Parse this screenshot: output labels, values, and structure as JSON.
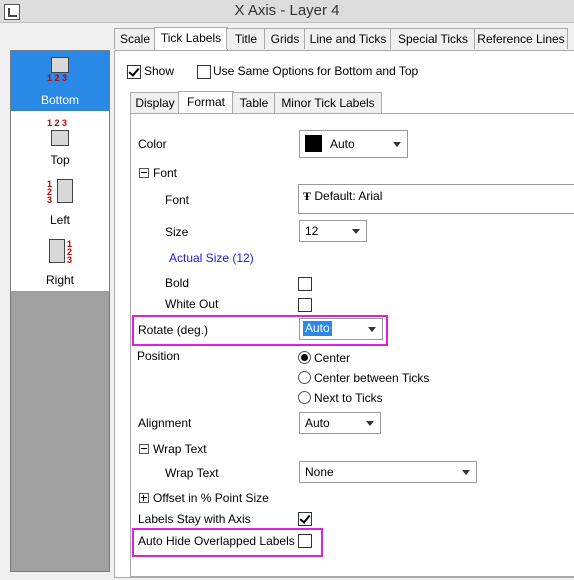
{
  "window": {
    "title": "X Axis - Layer 4"
  },
  "axes": [
    {
      "label": "Bottom",
      "nums": "1 2 3",
      "selected": true
    },
    {
      "label": "Top",
      "nums": "1 2 3",
      "selected": false
    },
    {
      "label": "Left",
      "nums": "1 2 3",
      "selected": false
    },
    {
      "label": "Right",
      "nums": "1 2 3",
      "selected": false
    }
  ],
  "tabs": [
    "Scale",
    "Tick Labels",
    "Title",
    "Grids",
    "Line and Ticks",
    "Special Ticks",
    "Reference Lines"
  ],
  "active_tab": "Tick Labels",
  "show": {
    "label": "Show",
    "checked": true
  },
  "same_options": {
    "label": "Use Same Options for Bottom and Top",
    "checked": false
  },
  "subtabs": [
    "Display",
    "Format",
    "Table",
    "Minor Tick Labels"
  ],
  "active_subtab": "Format",
  "format": {
    "color_label": "Color",
    "color_value": "Auto",
    "font_group": "Font",
    "font_label": "Font",
    "font_value": "Default: Arial",
    "size_label": "Size",
    "size_value": "12",
    "actual_size": "Actual Size (12)",
    "bold_label": "Bold",
    "bold_checked": false,
    "whiteout_label": "White Out",
    "whiteout_checked": false,
    "rotate_label": "Rotate (deg.)",
    "rotate_value": "Auto",
    "position_label": "Position",
    "position_options": [
      "Center",
      "Center between Ticks",
      "Next to Ticks"
    ],
    "position_selected": "Center",
    "alignment_label": "Alignment",
    "alignment_value": "Auto",
    "wrap_group": "Wrap Text",
    "wrap_label": "Wrap Text",
    "wrap_value": "None",
    "offset_group": "Offset in % Point Size",
    "stay_label": "Labels Stay with Axis",
    "stay_checked": true,
    "autohide_label": "Auto Hide Overlapped Labels",
    "autohide_checked": false
  },
  "colors": {
    "selection": "#2a89e6",
    "highlight": "#e020e0",
    "link": "#1a1aee",
    "tick_numbers": "#c00000"
  }
}
